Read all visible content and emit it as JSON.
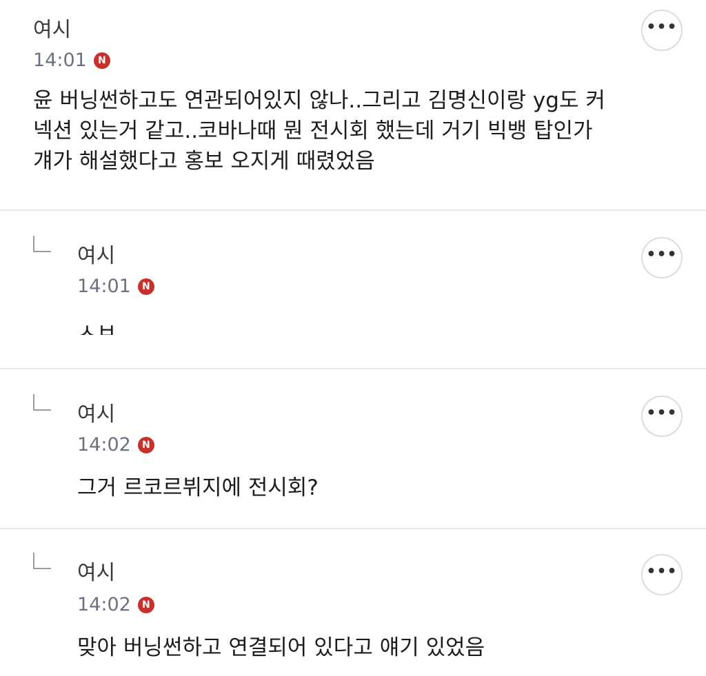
{
  "comments": [
    {
      "author": "여시",
      "time": "14:01",
      "badge": "N",
      "text_lines": [
        "윤 버닝썬하고도 연관되어있지 않나..그리고 김명신이랑 yg도 커",
        "넥션 있는거 같고..코바나때 뭔 전시회 했는데 거기 빅뱅 탑인가",
        "걔가 해설했다고 홍보 오지게 때렸었음"
      ],
      "more": "•••"
    },
    {
      "author": "여시",
      "time": "14:01",
      "badge": "N",
      "text_lines": [
        "ㅅㅂ"
      ],
      "more": "•••"
    },
    {
      "author": "여시",
      "time": "14:02",
      "badge": "N",
      "text_lines": [
        "그거 르코르뷔지에 전시회?"
      ],
      "more": "•••"
    },
    {
      "author": "여시",
      "time": "14:02",
      "badge": "N",
      "text_lines": [
        "맞아 버닝썬하고 연결되어 있다고 얘기 있었음"
      ],
      "more": "•••"
    }
  ]
}
